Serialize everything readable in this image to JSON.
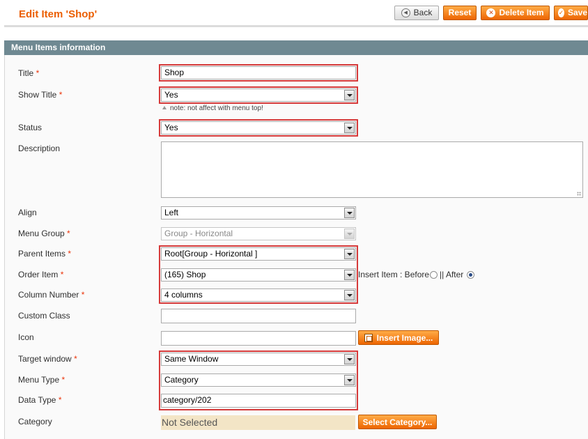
{
  "header": {
    "title": "Edit Item 'Shop'",
    "buttons": {
      "back": "Back",
      "reset": "Reset",
      "delete": "Delete Item",
      "save": "Save"
    }
  },
  "section": {
    "title": "Menu Items information"
  },
  "fields": {
    "title": {
      "label": "Title",
      "required": "*",
      "value": "Shop"
    },
    "show_title": {
      "label": "Show Title",
      "required": "*",
      "value": "Yes",
      "note": "note: not affect with menu top!"
    },
    "status": {
      "label": "Status",
      "value": "Yes"
    },
    "description": {
      "label": "Description",
      "value": ""
    },
    "align": {
      "label": "Align",
      "value": "Left"
    },
    "menu_group": {
      "label": "Menu Group",
      "required": "*",
      "value": "Group - Horizontal"
    },
    "parent_items": {
      "label": "Parent Items",
      "required": "*",
      "value": "Root[Group - Horizontal ]"
    },
    "order_item": {
      "label": "Order Item",
      "required": "*",
      "value": "(165) Shop",
      "insert_label": "Insert Item : Before",
      "separator": "|| After",
      "selected_position": "after"
    },
    "column_number": {
      "label": "Column Number",
      "required": "*",
      "value": "4 columns"
    },
    "custom_class": {
      "label": "Custom Class",
      "value": ""
    },
    "icon": {
      "label": "Icon",
      "value": "",
      "button": "Insert Image..."
    },
    "target_window": {
      "label": "Target window",
      "required": "*",
      "value": "Same Window"
    },
    "menu_type": {
      "label": "Menu Type",
      "required": "*",
      "value": "Category"
    },
    "data_type": {
      "label": "Data Type",
      "required": "*",
      "value": "category/202"
    },
    "category": {
      "label": "Category",
      "value": "Not Selected",
      "button": "Select Category..."
    }
  },
  "colors": {
    "title_orange": "#eb5e00",
    "section_header": "#6f8992",
    "highlight_red": "#d53a3a",
    "button_orange": "#ed6502"
  },
  "icons": {
    "back": "left-arrow-circle-icon",
    "delete": "cancel-circle-icon",
    "save": "checkmark-circle-icon",
    "insert_image": "image-icon"
  }
}
